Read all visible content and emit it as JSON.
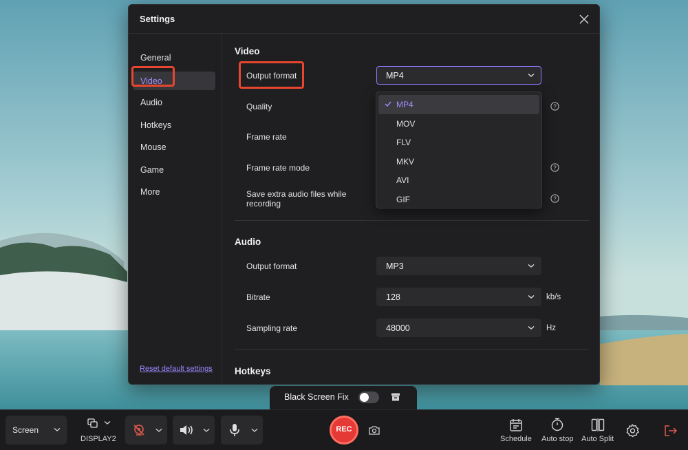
{
  "settings": {
    "title": "Settings",
    "nav": [
      "General",
      "Video",
      "Audio",
      "Hotkeys",
      "Mouse",
      "Game",
      "More"
    ],
    "active_nav": "Video",
    "reset_link": "Reset default settings"
  },
  "video": {
    "title": "Video",
    "output_format_label": "Output format",
    "output_format_value": "MP4",
    "quality_label": "Quality",
    "frame_rate_label": "Frame rate",
    "frame_rate_mode_label": "Frame rate mode",
    "extra_audio_label": "Save extra audio files while recording",
    "format_options": [
      "MP4",
      "MOV",
      "FLV",
      "MKV",
      "AVI",
      "GIF"
    ],
    "selected_option": "MP4"
  },
  "audio": {
    "title": "Audio",
    "output_format_label": "Output format",
    "output_format_value": "MP3",
    "bitrate_label": "Bitrate",
    "bitrate_value": "128",
    "bitrate_unit": "kb/s",
    "sampling_label": "Sampling rate",
    "sampling_value": "48000",
    "sampling_unit": "Hz"
  },
  "hotkeys": {
    "title": "Hotkeys"
  },
  "black_screen_fix": {
    "label": "Black Screen Fix",
    "enabled": false
  },
  "toolbar": {
    "mode": "Screen",
    "display": "DISPLAY2",
    "rec": "REC",
    "schedule": "Schedule",
    "auto_stop": "Auto stop",
    "auto_split": "Auto Split"
  },
  "colors": {
    "accent": "#a58cff",
    "highlight": "#e8462e",
    "rec": "#e53935"
  }
}
